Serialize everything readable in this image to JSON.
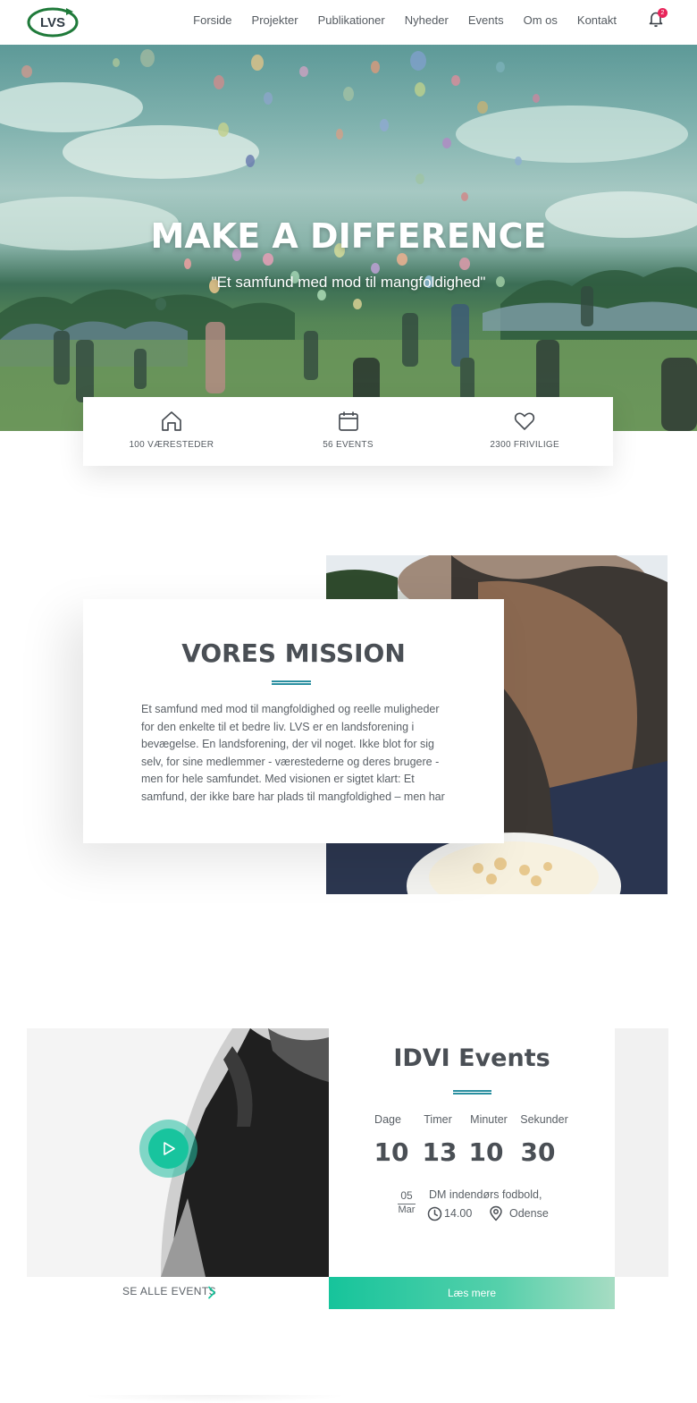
{
  "nav": {
    "logo_text": "LVS",
    "links": [
      "Forside",
      "Projekter",
      "Publikationer",
      "Nyheder",
      "Events",
      "Om os",
      "Kontakt"
    ],
    "notification_count": "2",
    "brand_color": "#1f7a3a",
    "badge_color": "#e8245a"
  },
  "hero": {
    "title": "MAKE A DIFFERENCE",
    "subtitle": "\"Et samfund med mod til mangfoldighed\""
  },
  "stats": [
    {
      "icon": "home-icon",
      "label": "100 VÆRESTEDER"
    },
    {
      "icon": "calendar-icon",
      "label": "56 EVENTS"
    },
    {
      "icon": "heart-icon",
      "label": "2300 FRIVILIGE"
    }
  ],
  "mission": {
    "title": "VORES MISSION",
    "text": "Et samfund med mod til mangfoldighed og reelle muligheder for den enkelte til et bedre liv. LVS er en landsforening i bevægelse. En landsforening, der vil noget. Ikke blot for sig selv, for sine medlemmer - værestederne og deres brugere - men for hele samfundet. Med visionen er sigtet klart: Et samfund, der ikke bare har plads til mangfoldighed – men har mod til mangfoldighed. Et",
    "accent_color": "#2a8fa0"
  },
  "events": {
    "title": "IDVI Events",
    "countdown": {
      "days_label": "Dage",
      "days": "10",
      "hours_label": "Timer",
      "hours": "13",
      "minutes_label": "Minuter",
      "minutes": "10",
      "seconds_label": "Sekunder",
      "seconds": "30"
    },
    "next": {
      "day": "05",
      "month": "Mar",
      "name": "DM indendørs fodbold,",
      "time": "14.00",
      "location": "Odense"
    },
    "see_all_label": "SE ALLE EVENTS",
    "read_more_label": "Læs mere",
    "accent_color": "#16c49b"
  }
}
